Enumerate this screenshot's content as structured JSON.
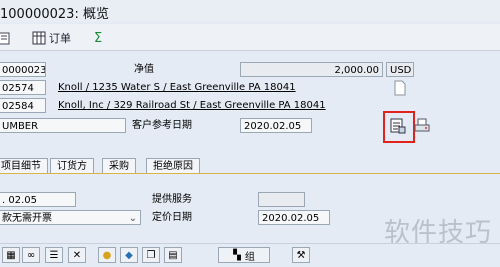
{
  "window": {
    "title": "100000023: 概览"
  },
  "toolbar": {
    "order_label": "订单",
    "sum_symbol": "Σ"
  },
  "header": {
    "doc_number": "0000023",
    "net_value_label": "净值",
    "net_value": "2,000.00",
    "currency": "USD",
    "sold_to_id": "02574",
    "sold_to_address": "Knoll / 1235 Water S / East Greenville PA 18041",
    "ship_to_id": "02584",
    "ship_to_address": "Knoll, Inc / 329 Railroad St / East Greenville PA 18041",
    "po_number": "UMBER",
    "cust_ref_date_label": "客户参考日期",
    "cust_ref_date": "2020.02.05"
  },
  "tabs": [
    "项目细节",
    "订货方",
    "采购",
    "拒绝原因"
  ],
  "detail": {
    "req_date": ". 02.05",
    "billing_block": "款无需开票",
    "service_label": "提供服务",
    "pricing_date_label": "定价日期",
    "pricing_date": "2020.02.05"
  },
  "bottom": {
    "group_label": "组"
  },
  "watermark": "软件技巧",
  "colors": {
    "highlight": "#e0241b",
    "tab_separator": "#d8b44a"
  }
}
